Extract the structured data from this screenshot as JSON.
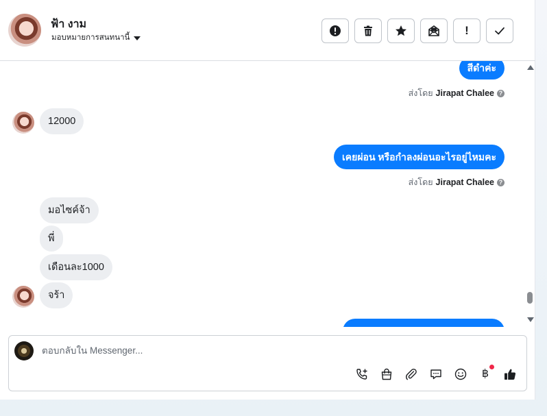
{
  "header": {
    "contact_name": "ฟ้า งาม",
    "assign_label": "มอบหมายการสนทนานี้",
    "toolbar": [
      {
        "id": "spam",
        "icon": "alert-circle-icon"
      },
      {
        "id": "delete",
        "icon": "trash-icon"
      },
      {
        "id": "star",
        "icon": "star-icon"
      },
      {
        "id": "mark-unread",
        "icon": "envelope-open-icon"
      },
      {
        "id": "follow-up",
        "icon": "exclamation-icon",
        "label": "!"
      },
      {
        "id": "done",
        "icon": "checkmark-icon"
      }
    ]
  },
  "messages": [
    {
      "direction": "out",
      "text": "สีดำค่ะ",
      "sent_by_prefix": "ส่งโดย",
      "sent_by_name": "Jirapat Chalee"
    },
    {
      "direction": "in",
      "text": "12000"
    },
    {
      "direction": "out",
      "text": "เคยผ่อน หรือกำลงผ่อนอะไรอยู่ไหมคะ",
      "sent_by_prefix": "ส่งโดย",
      "sent_by_name": "Jirapat Chalee"
    },
    {
      "direction": "in",
      "text": "มอไซค์จ้า"
    },
    {
      "direction": "in",
      "text": "พี่"
    },
    {
      "direction": "in",
      "text": "เดือนละ1000"
    },
    {
      "direction": "in",
      "text": "จร้า"
    },
    {
      "direction": "out",
      "text": ""
    }
  ],
  "composer": {
    "placeholder": "ตอบกลับใน Messenger...",
    "value": "",
    "tools": [
      "phone-add-icon",
      "shopping-bag-icon",
      "paperclip-icon",
      "chat-bubbles-icon",
      "emoji-icon",
      "baht-icon",
      "thumbs-up-icon"
    ],
    "baht_symbol": "฿",
    "accent_color": "#0a7cff",
    "notification_color": "#f02849"
  }
}
